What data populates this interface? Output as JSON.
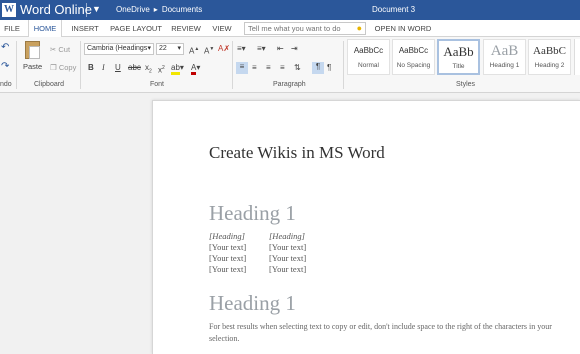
{
  "titlebar": {
    "logo_letter": "W",
    "app_name": "Word Online",
    "breadcrumb_root": "OneDrive",
    "breadcrumb_sep": "▸",
    "breadcrumb_folder": "Documents",
    "document_name": "Document 3"
  },
  "tabs": {
    "file": "FILE",
    "home": "HOME",
    "insert": "INSERT",
    "page_layout": "PAGE LAYOUT",
    "review": "REVIEW",
    "view": "VIEW",
    "tell_me_placeholder": "Tell me what you want to do",
    "open_in_word": "OPEN IN WORD"
  },
  "ribbon": {
    "undo_label": "ndo",
    "clipboard": {
      "label": "Clipboard",
      "paste": "Paste",
      "cut": "Cut",
      "copy": "Copy"
    },
    "font": {
      "label": "Font",
      "family": "Cambria (Headings",
      "size": "22"
    },
    "paragraph": {
      "label": "Paragraph"
    },
    "styles": {
      "label": "Styles",
      "items": [
        {
          "sample": "AaBbCc",
          "name": "Normal"
        },
        {
          "sample": "AaBbCc",
          "name": "No Spacing"
        },
        {
          "sample": "AaBb",
          "name": "Title"
        },
        {
          "sample": "AaB",
          "name": "Heading 1"
        },
        {
          "sample": "AaBbC",
          "name": "Heading 2"
        }
      ]
    }
  },
  "document": {
    "title": "Create Wikis in MS Word",
    "heading_1": "Heading 1",
    "table": {
      "col1": [
        "[Heading]",
        "[Your text]",
        "[Your text]",
        "[Your text]"
      ],
      "col2": [
        "[Heading]",
        "[Your text]",
        "[Your text]",
        "[Your text]"
      ]
    },
    "heading_2": "Heading 1",
    "paragraph": "For best results when selecting text to copy or edit, don't include space to the right of the characters in your selection."
  }
}
